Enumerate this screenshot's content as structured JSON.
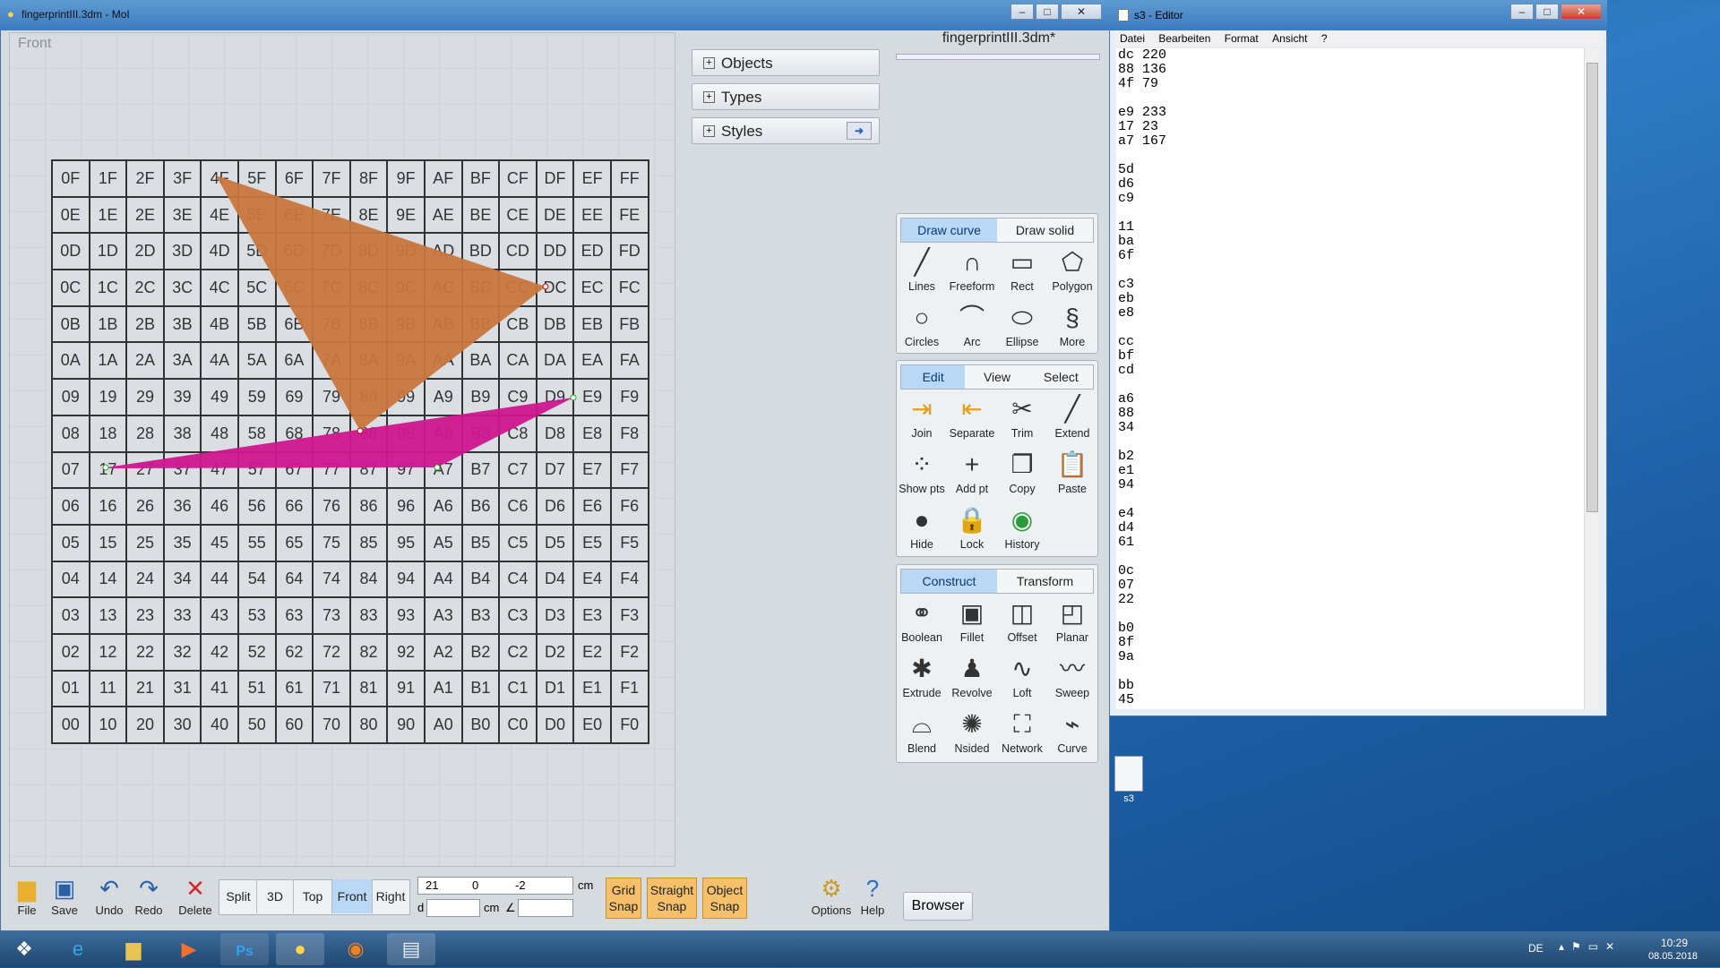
{
  "moi": {
    "title": "fingerprintIII.3dm - MoI",
    "viewport_label": "Front",
    "grid": [
      [
        "0F",
        "1F",
        "2F",
        "3F",
        "4F",
        "5F",
        "6F",
        "7F",
        "8F",
        "9F",
        "AF",
        "BF",
        "CF",
        "DF",
        "EF",
        "FF"
      ],
      [
        "0E",
        "1E",
        "2E",
        "3E",
        "4E",
        "5E",
        "6E",
        "7E",
        "8E",
        "9E",
        "AE",
        "BE",
        "CE",
        "DE",
        "EE",
        "FE"
      ],
      [
        "0D",
        "1D",
        "2D",
        "3D",
        "4D",
        "5D",
        "6D",
        "7D",
        "8D",
        "9D",
        "AD",
        "BD",
        "CD",
        "DD",
        "ED",
        "FD"
      ],
      [
        "0C",
        "1C",
        "2C",
        "3C",
        "4C",
        "5C",
        "6C",
        "7C",
        "8C",
        "9C",
        "AC",
        "BC",
        "CC",
        "DC",
        "EC",
        "FC"
      ],
      [
        "0B",
        "1B",
        "2B",
        "3B",
        "4B",
        "5B",
        "6B",
        "7B",
        "8B",
        "9B",
        "AB",
        "BB",
        "CB",
        "DB",
        "EB",
        "FB"
      ],
      [
        "0A",
        "1A",
        "2A",
        "3A",
        "4A",
        "5A",
        "6A",
        "7A",
        "8A",
        "9A",
        "AA",
        "BA",
        "CA",
        "DA",
        "EA",
        "FA"
      ],
      [
        "09",
        "19",
        "29",
        "39",
        "49",
        "59",
        "69",
        "79",
        "89",
        "99",
        "A9",
        "B9",
        "C9",
        "D9",
        "E9",
        "F9"
      ],
      [
        "08",
        "18",
        "28",
        "38",
        "48",
        "58",
        "68",
        "78",
        "88",
        "98",
        "A8",
        "B8",
        "C8",
        "D8",
        "E8",
        "F8"
      ],
      [
        "07",
        "17",
        "27",
        "37",
        "47",
        "57",
        "67",
        "77",
        "87",
        "97",
        "A7",
        "B7",
        "C7",
        "D7",
        "E7",
        "F7"
      ],
      [
        "06",
        "16",
        "26",
        "36",
        "46",
        "56",
        "66",
        "76",
        "86",
        "96",
        "A6",
        "B6",
        "C6",
        "D6",
        "E6",
        "F6"
      ],
      [
        "05",
        "15",
        "25",
        "35",
        "45",
        "55",
        "65",
        "75",
        "85",
        "95",
        "A5",
        "B5",
        "C5",
        "D5",
        "E5",
        "F5"
      ],
      [
        "04",
        "14",
        "24",
        "34",
        "44",
        "54",
        "64",
        "74",
        "84",
        "94",
        "A4",
        "B4",
        "C4",
        "D4",
        "E4",
        "F4"
      ],
      [
        "03",
        "13",
        "23",
        "33",
        "43",
        "53",
        "63",
        "73",
        "83",
        "93",
        "A3",
        "B3",
        "C3",
        "D3",
        "E3",
        "F3"
      ],
      [
        "02",
        "12",
        "22",
        "32",
        "42",
        "52",
        "62",
        "72",
        "82",
        "92",
        "A2",
        "B2",
        "C2",
        "D2",
        "E2",
        "F2"
      ],
      [
        "01",
        "11",
        "21",
        "31",
        "41",
        "51",
        "61",
        "71",
        "81",
        "91",
        "A1",
        "B1",
        "C1",
        "D1",
        "E1",
        "F1"
      ],
      [
        "00",
        "10",
        "20",
        "30",
        "40",
        "50",
        "60",
        "70",
        "80",
        "90",
        "A0",
        "B0",
        "C0",
        "D0",
        "E0",
        "F0"
      ]
    ],
    "shape_colors": {
      "orange": "#c8763c",
      "magenta": "#d0168f"
    },
    "accordion": {
      "objects": "Objects",
      "types": "Types",
      "styles": "Styles"
    },
    "doc_title": "fingerprintIII.3dm*",
    "draw_tabs": {
      "curve": "Draw curve",
      "solid": "Draw solid"
    },
    "draw_tools": [
      "Lines",
      "Freeform",
      "Rect",
      "Polygon",
      "Circles",
      "Arc",
      "Ellipse",
      "More"
    ],
    "edit_tabs": {
      "edit": "Edit",
      "view": "View",
      "select": "Select"
    },
    "edit_tools": [
      "Join",
      "Separate",
      "Trim",
      "Extend",
      "Show pts",
      "Add pt",
      "Copy",
      "Paste",
      "Hide",
      "Lock",
      "History"
    ],
    "construct_tabs": {
      "construct": "Construct",
      "transform": "Transform"
    },
    "construct_tools": [
      "Boolean",
      "Fillet",
      "Offset",
      "Planar",
      "Extrude",
      "Revolve",
      "Loft",
      "Sweep",
      "Blend",
      "Nsided",
      "Network",
      "Curve"
    ],
    "bottom": {
      "file": "File",
      "save": "Save",
      "undo": "Undo",
      "redo": "Redo",
      "delete": "Delete",
      "views": [
        "Split",
        "3D",
        "Top",
        "Front",
        "Right"
      ],
      "coord_x": "21",
      "coord_y": "0",
      "coord_z": "-2",
      "unit": "cm",
      "d_label": "d",
      "d_unit": "cm",
      "angle_label": "∠",
      "grid_snap": [
        "Grid",
        "Snap"
      ],
      "straight_snap": [
        "Straight",
        "Snap"
      ],
      "object_snap": [
        "Object",
        "Snap"
      ],
      "options": "Options",
      "help": "Help",
      "browser": "Browser"
    }
  },
  "editor": {
    "title": "s3 - Editor",
    "menu": [
      "Datei",
      "Bearbeiten",
      "Format",
      "Ansicht",
      "?"
    ],
    "text": "dc 220\n88 136\n4f 79\n\ne9 233\n17 23\na7 167\n\n5d\nd6\nc9\n\n11\nba\n6f\n\nc3\neb\ne8\n\ncc\nbf\ncd\n\na6\n88\n34\n\nb2\ne1\n94\n\ne4\nd4\n61\n\n0c\n07\n22\n\nb0\n8f\n9a\n\nbb\n45"
  },
  "desktop": {
    "file_icon_label": "s3"
  },
  "taskbar": {
    "lang": "DE",
    "time": "10:29",
    "date": "08.05.2018"
  }
}
